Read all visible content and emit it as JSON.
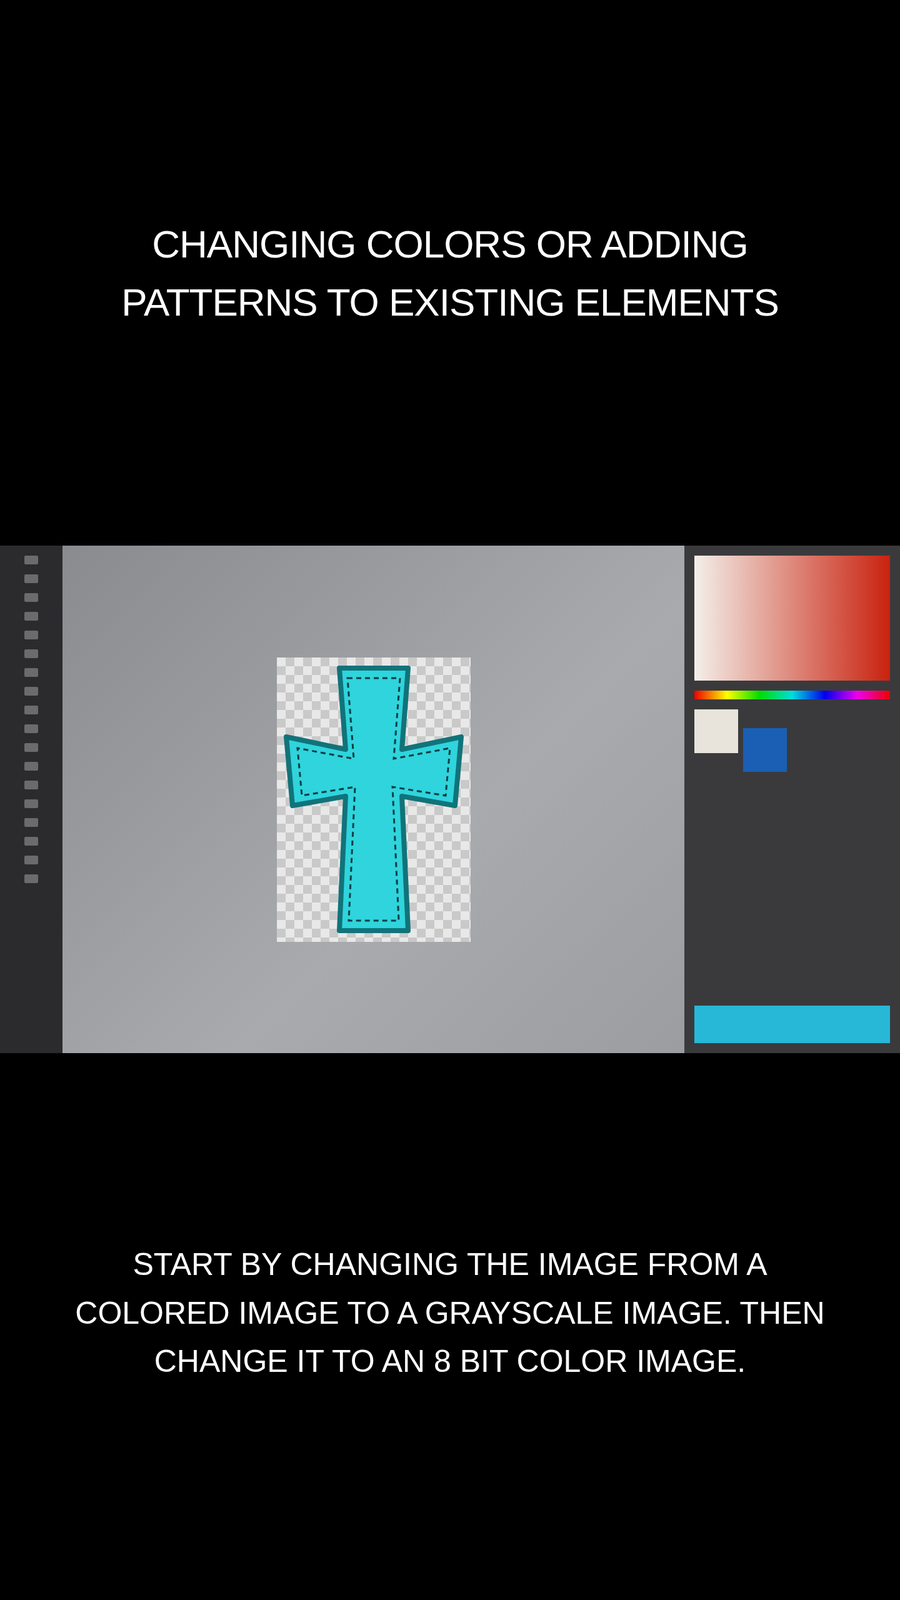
{
  "title": "CHANGING COLORS OR ADDING PATTERNS TO EXISTING ELEMENTS",
  "caption": "START BY CHANGING THE IMAGE FROM A COLORED IMAGE TO A GRAYSCALE IMAGE. THEN CHANGE IT TO AN 8 BIT COLOR IMAGE."
}
